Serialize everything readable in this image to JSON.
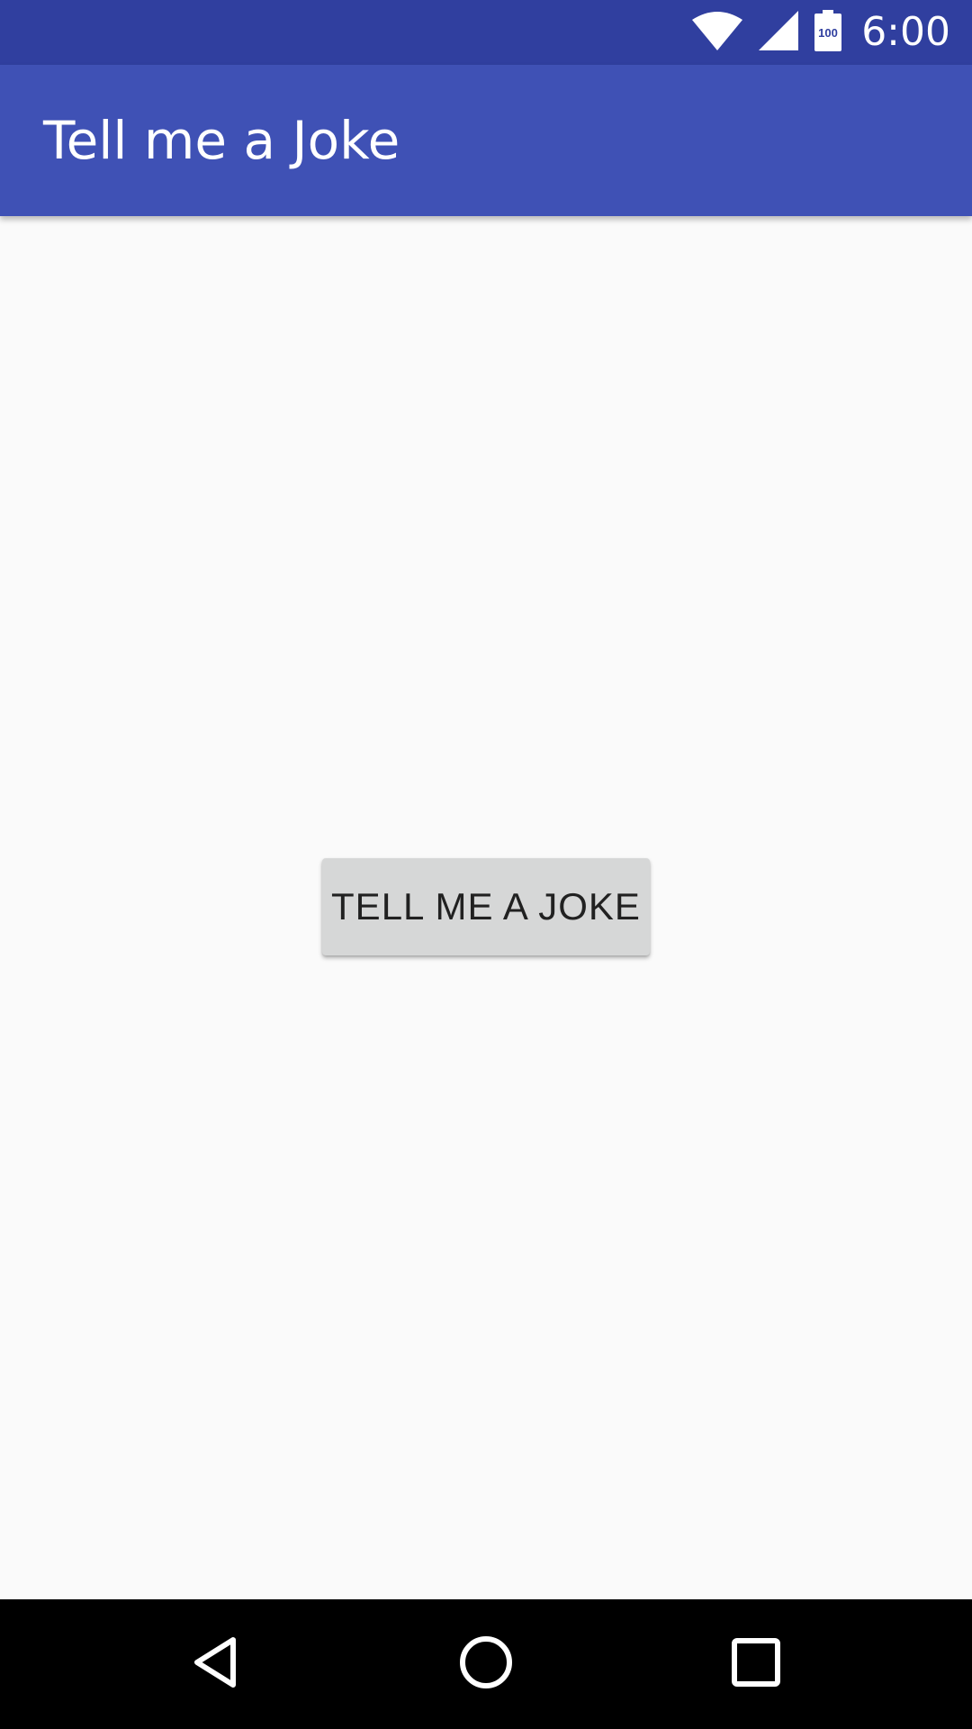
{
  "status_bar": {
    "time": "6:00",
    "battery_level": "100",
    "icons": [
      "wifi-icon",
      "cellular-signal-icon",
      "battery-icon"
    ]
  },
  "app_bar": {
    "title": "Tell me a Joke"
  },
  "main": {
    "joke_button_label": "TELL ME A JOKE"
  },
  "nav_bar": {
    "icons": [
      "back-icon",
      "home-icon",
      "recents-icon"
    ]
  },
  "colors": {
    "status_bar": "#303F9F",
    "app_bar": "#3F51B5",
    "background": "#FAFAFA",
    "button": "#D6D7D7",
    "button_text": "#212121",
    "nav_bar": "#000000"
  }
}
